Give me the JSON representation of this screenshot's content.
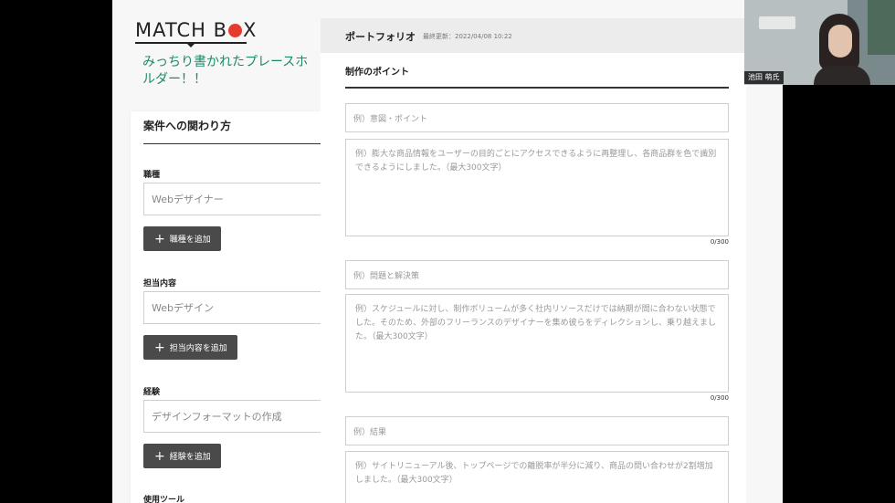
{
  "logo": {
    "text_before": "MATCH B",
    "text_after": "X"
  },
  "tagline": "みっちり書かれたプレースホルダー！！",
  "left_card": {
    "title": "案件への関わり方",
    "fields": [
      {
        "label": "職種",
        "value": "Webデザイナー",
        "add_label": "職種を追加"
      },
      {
        "label": "担当内容",
        "value": "Webデザイン",
        "add_label": "担当内容を追加"
      },
      {
        "label": "経験",
        "value": "デザインフォーマットの作成",
        "add_label": "経験を追加"
      }
    ],
    "next_label": "使用ツール"
  },
  "portfolio": {
    "title": "ポートフォリオ",
    "updated": "最終更新：2022/04/08 10:22",
    "section_title": "制作のポイント",
    "blocks": [
      {
        "input_placeholder": "例）意図・ポイント",
        "textarea_placeholder": "例）膨大な商品情報をユーザーの目的ごとにアクセスできるように再整理し、各商品群を色で識別できるようにしました。（最大300文字）",
        "counter": "0/300"
      },
      {
        "input_placeholder": "例）問題と解決策",
        "textarea_placeholder": "例）スケジュールに対し、制作ボリュームが多く社内リソースだけでは納期が間に合わない状態でした。そのため、外部のフリーランスのデザイナーを集め彼らをディレクションし、乗り越えました。（最大300文字）",
        "counter": "0/300"
      },
      {
        "input_placeholder": "例）結果",
        "textarea_placeholder": "例）サイトリニューアル後、トップページでの離脱率が半分に減り、商品の問い合わせが2割増加しました。（最大300文字）"
      }
    ]
  },
  "video": {
    "participant_name": "池田 萌氏"
  },
  "colors": {
    "accent_green": "#1e8a6a",
    "logo_red": "#e53a2f",
    "button_dark": "#4a4a4a"
  }
}
